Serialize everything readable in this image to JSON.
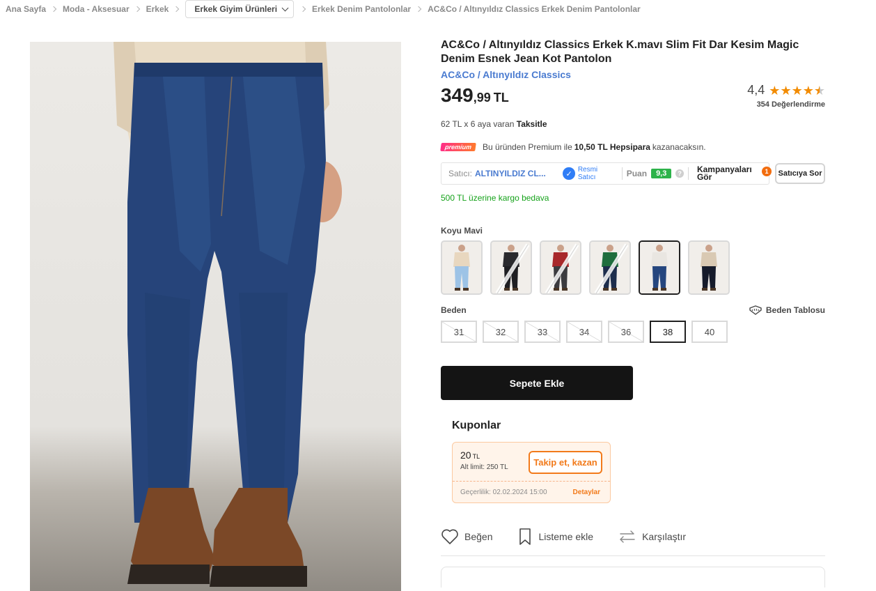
{
  "breadcrumb": {
    "items": [
      "Ana Sayfa",
      "Moda - Aksesuar",
      "Erkek"
    ],
    "dropdown": "Erkek Giyim Ürünleri",
    "tail": [
      "Erkek Denim Pantolonlar",
      "AC&Co / Altınyıldız Classics Erkek Denim Pantolonlar"
    ]
  },
  "product": {
    "title": "AC&Co / Altınyıldız Classics Erkek K.mavı Slim Fit Dar Kesim Magic Denim Esnek Jean Kot Pantolon",
    "brand": "AC&Co / Altınyıldız Classics",
    "price_main": "349",
    "price_decimal": ",99",
    "price_currency": "TL",
    "rating_value": "4,4",
    "rating": 4.4,
    "rating_count": "354 Değerlendirme",
    "installment_text": "62 TL x 6 aya varan",
    "installment_bold": "Taksitle",
    "premium_badge": "premium",
    "premium_text_1": "Bu üründen Premium ile",
    "premium_amount": "10,50 TL Hepsipara",
    "premium_text_2": "kazanacaksın."
  },
  "seller": {
    "label": "Satıcı:",
    "name": "ALTINYILDIZ CL...",
    "official_label": "Resmi Satıcı",
    "score_label": "Puan",
    "score": "9,3",
    "help": "?",
    "campaign_label": "Kampanyaları Gör",
    "campaign_count": "1",
    "ask_button": "Satıcıya Sor"
  },
  "shipping": "500 TL üzerine kargo bedava",
  "variants": {
    "label": "Koyu Mavi",
    "items": [
      {
        "name": "light-blue-jeans",
        "pant": "#9dc3e6",
        "top": "#e8d7bf",
        "disabled": false,
        "selected": false
      },
      {
        "name": "black-jeans",
        "pant": "#1e1e22",
        "top": "#2a2a2e",
        "disabled": true,
        "selected": false
      },
      {
        "name": "grey-jeans",
        "pant": "#3b3b3f",
        "top": "#a8282b",
        "disabled": true,
        "selected": false
      },
      {
        "name": "dark-blue-jeans",
        "pant": "#1d2d4c",
        "top": "#1f6e3e",
        "disabled": true,
        "selected": false
      },
      {
        "name": "navy-jeans",
        "pant": "#25467e",
        "top": "#e9e6e1",
        "disabled": false,
        "selected": true
      },
      {
        "name": "midnight-jeans",
        "pant": "#161b2b",
        "top": "#d9c9b3",
        "disabled": false,
        "selected": false
      }
    ]
  },
  "sizes": {
    "label": "Beden",
    "chart_label": "Beden Tablosu",
    "items": [
      {
        "label": "31",
        "disabled": true,
        "selected": false
      },
      {
        "label": "32",
        "disabled": true,
        "selected": false
      },
      {
        "label": "33",
        "disabled": true,
        "selected": false
      },
      {
        "label": "34",
        "disabled": true,
        "selected": false
      },
      {
        "label": "36",
        "disabled": true,
        "selected": false
      },
      {
        "label": "38",
        "disabled": false,
        "selected": true
      },
      {
        "label": "40",
        "disabled": false,
        "selected": false
      }
    ]
  },
  "cart_button": "Sepete Ekle",
  "coupons": {
    "title": "Kuponlar",
    "amount": "20",
    "amount_currency": "TL",
    "limit": "Alt limit: 250 TL",
    "button": "Takip et, kazan",
    "validity": "Geçerlilik: 02.02.2024 15:00",
    "details": "Detaylar"
  },
  "actions": {
    "like": "Beğen",
    "list": "Listeme ekle",
    "compare": "Karşılaştır"
  },
  "colors": {
    "brand_blue": "#4a7bd0",
    "orange": "#f27a1a",
    "green": "#15a21a",
    "cart_bg": "#141414"
  }
}
